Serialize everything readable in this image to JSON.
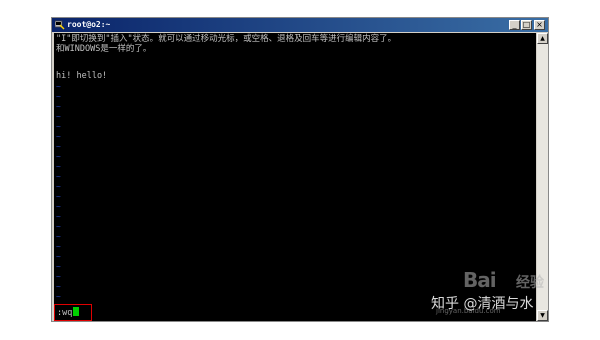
{
  "window": {
    "title": "root@o2:~",
    "minimize_label": "_",
    "maximize_label": "□",
    "close_label": "×"
  },
  "terminal": {
    "lines": [
      "\"I\"即切换到\"插入\"状态。就可以通过移动光标，或空格、退格及回车等进行编辑内容了。",
      "和WINDOWS是一样的了。",
      "",
      "hi! hello!"
    ],
    "tilde_char": "~",
    "command": ":wq"
  },
  "scrollbar": {
    "up_label": "▲",
    "down_label": "▼"
  },
  "watermark": {
    "baidu": "Bai",
    "jingyan": "经验",
    "zhihu": "知乎 @清酒与水",
    "url": "jingyan.baidu.com"
  }
}
